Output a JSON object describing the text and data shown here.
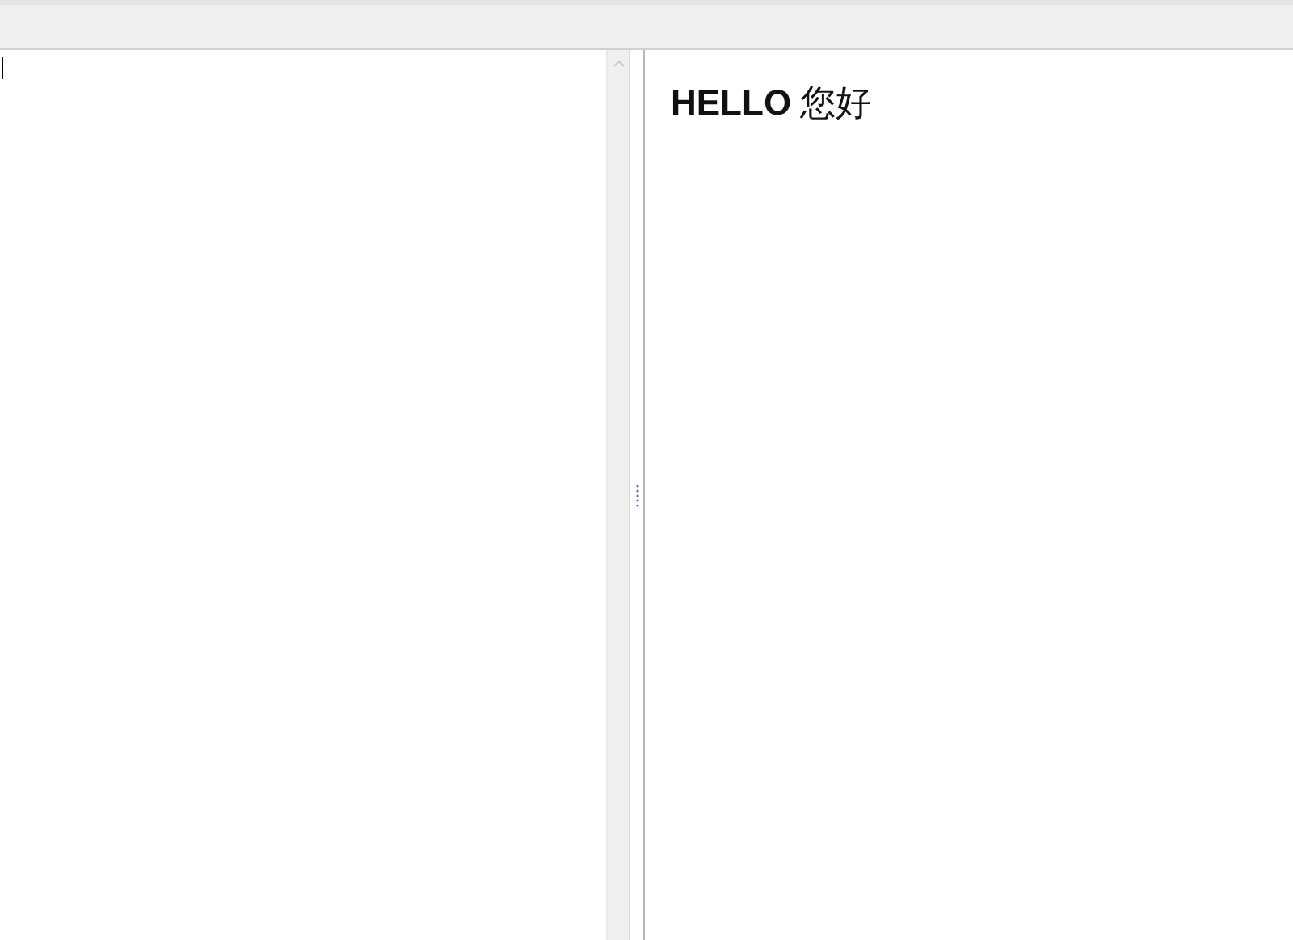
{
  "preview": {
    "heading": "**HELLO** 您好"
  }
}
